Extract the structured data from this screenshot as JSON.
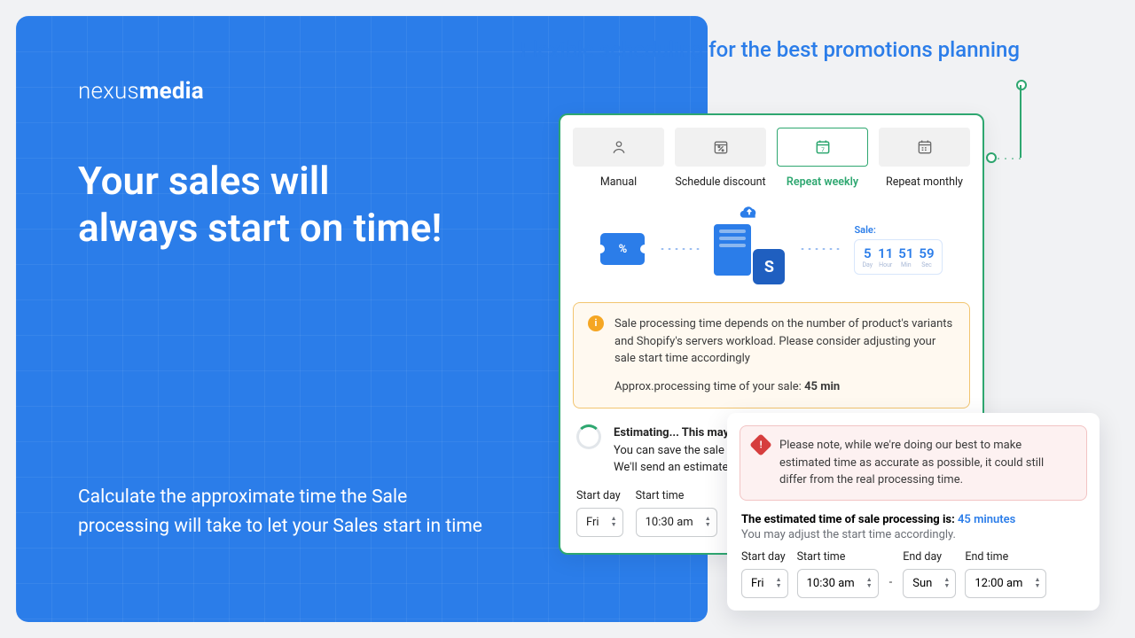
{
  "logo": {
    "thin": "nexus",
    "bold": "media"
  },
  "headline": "Your sales will always start on time!",
  "subtext": "Calculate the approximate time the Sale processing will take to let your Sales start in time",
  "tagline": "Flexible scheduling for the best promotions planning",
  "tabs": {
    "manual": "Manual",
    "schedule": "Schedule discount",
    "weekly": "Repeat weekly",
    "monthly": "Repeat monthly"
  },
  "coupon_symbol": "%",
  "sale": {
    "label": "Sale:",
    "d": "5",
    "d_sub": "Day",
    "h": "11",
    "h_sub": "Hour",
    "m": "51",
    "m_sub": "Min",
    "s": "59",
    "s_sub": "Sec"
  },
  "info": {
    "text": "Sale processing time depends on the number of product's variants and Shopify's servers workload. Please consider adjusting your sale start time accordingly",
    "approx_prefix": "Approx.processing time of your sale: ",
    "approx_value": "45 min"
  },
  "estimating": {
    "title": "Estimating... This may",
    "line2": "You can save the sale",
    "line3": "We'll send an estimate"
  },
  "fields": {
    "start_day_label": "Start day",
    "start_time_label": "Start time",
    "end_day_label": "End day",
    "end_time_label": "End time",
    "start_day": "Fri",
    "start_time": "10:30 am",
    "end_day": "Sun",
    "end_time": "12:00 am",
    "dash": "-"
  },
  "warn": {
    "text": "Please note, while we're doing our best to make estimated time as accurate as possible, it could still differ from the real processing time."
  },
  "estimate": {
    "prefix": "The estimated time of sale processing is: ",
    "value": "45 minutes",
    "note": "You may adjust the start time accordingly."
  }
}
